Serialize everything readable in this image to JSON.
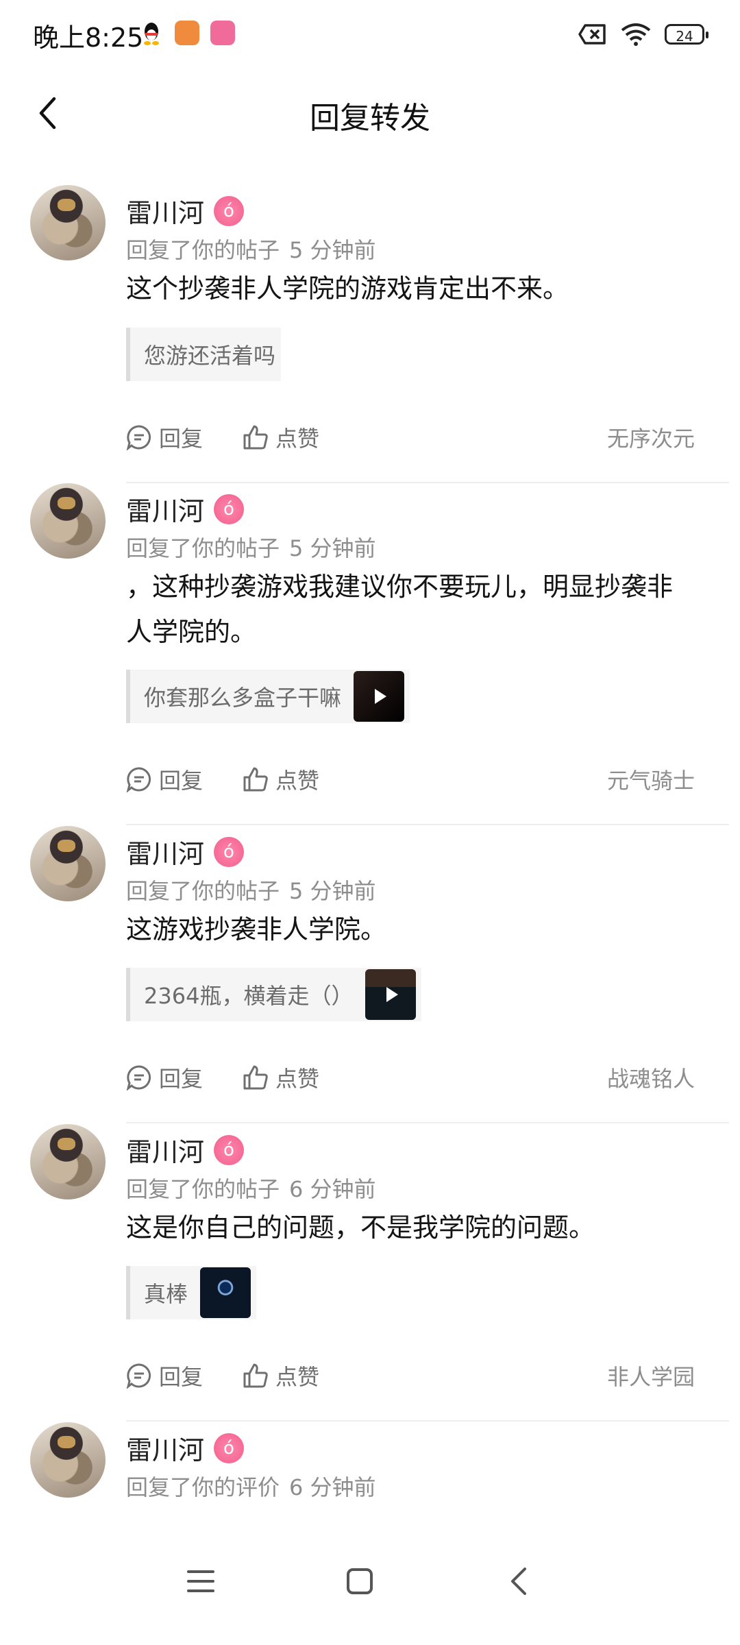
{
  "status_bar": {
    "time": "晚上8:25",
    "battery": "24",
    "icons": [
      "qq-icon",
      "app-icon",
      "bilibili-icon",
      "no-sim-icon",
      "wifi-icon",
      "battery-icon"
    ]
  },
  "header": {
    "title": "回复转发",
    "back_icon": "chevron-left-icon"
  },
  "items": [
    {
      "user": "雷川河",
      "badge": "ó",
      "action": "回复了你的帖子",
      "time": "5 分钟前",
      "content": "这个抄袭非人学院的游戏肯定出不来。",
      "quote": "您游还活着吗",
      "reply_label": "回复",
      "like_label": "点赞",
      "game": "无序次元"
    },
    {
      "user": "雷川河",
      "badge": "ó",
      "action": "回复了你的帖子",
      "time": "5 分钟前",
      "content": "，这种抄袭游戏我建议你不要玩儿，明显抄袭非人学院的。",
      "quote": "你套那么多盒子干嘛",
      "reply_label": "回复",
      "like_label": "点赞",
      "game": "元气骑士"
    },
    {
      "user": "雷川河",
      "badge": "ó",
      "action": "回复了你的帖子",
      "time": "5 分钟前",
      "content": "这游戏抄袭非人学院。",
      "quote": "2364瓶，横着走（）",
      "reply_label": "回复",
      "like_label": "点赞",
      "game": "战魂铭人"
    },
    {
      "user": "雷川河",
      "badge": "ó",
      "action": "回复了你的帖子",
      "time": "6 分钟前",
      "content": "这是你自己的问题，不是我学院的问题。",
      "quote": "真棒",
      "reply_label": "回复",
      "like_label": "点赞",
      "game": "非人学园"
    },
    {
      "user": "雷川河",
      "badge": "ó",
      "action": "回复了你的评价",
      "time": "6 分钟前"
    }
  ],
  "nav_bar": {
    "icons": [
      "menu-icon",
      "home-square-icon",
      "back-triangle-icon"
    ]
  }
}
